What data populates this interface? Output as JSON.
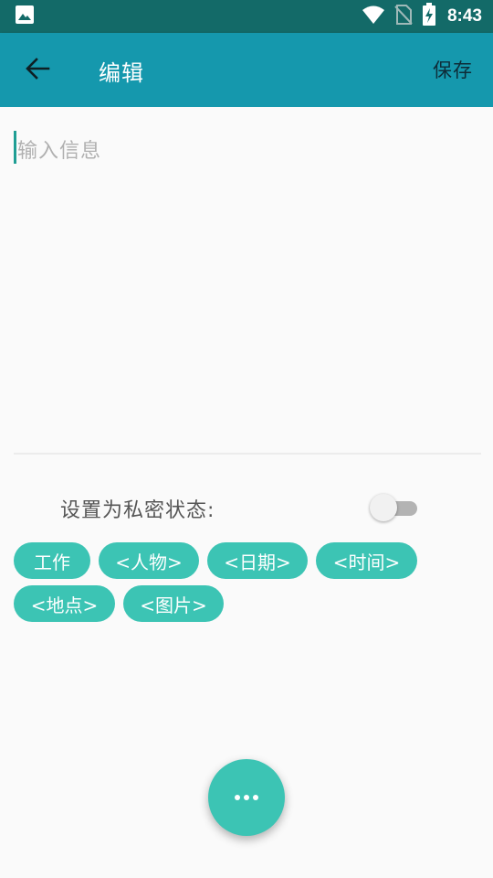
{
  "status_bar": {
    "time": "8:43",
    "icons": [
      "image-icon",
      "wifi-icon",
      "no-sim-icon",
      "battery-charging-icon"
    ]
  },
  "app_bar": {
    "title": "编辑",
    "save_label": "保存",
    "back_icon": "arrow-back-icon"
  },
  "editor": {
    "placeholder": "输入信息",
    "value": ""
  },
  "privacy": {
    "label": "设置为私密状态:",
    "enabled": false
  },
  "tags": [
    {
      "label": "工作"
    },
    {
      "label": "<人物>"
    },
    {
      "label": "<日期>"
    },
    {
      "label": "<时间>"
    },
    {
      "label": "<地点>"
    },
    {
      "label": "<图片>"
    }
  ],
  "fab": {
    "icon": "more-horizontal-icon"
  },
  "colors": {
    "status_bar": "#136a68",
    "app_bar": "#1598ad",
    "accent": "#3cc4b4",
    "cursor": "#1f9e94"
  }
}
